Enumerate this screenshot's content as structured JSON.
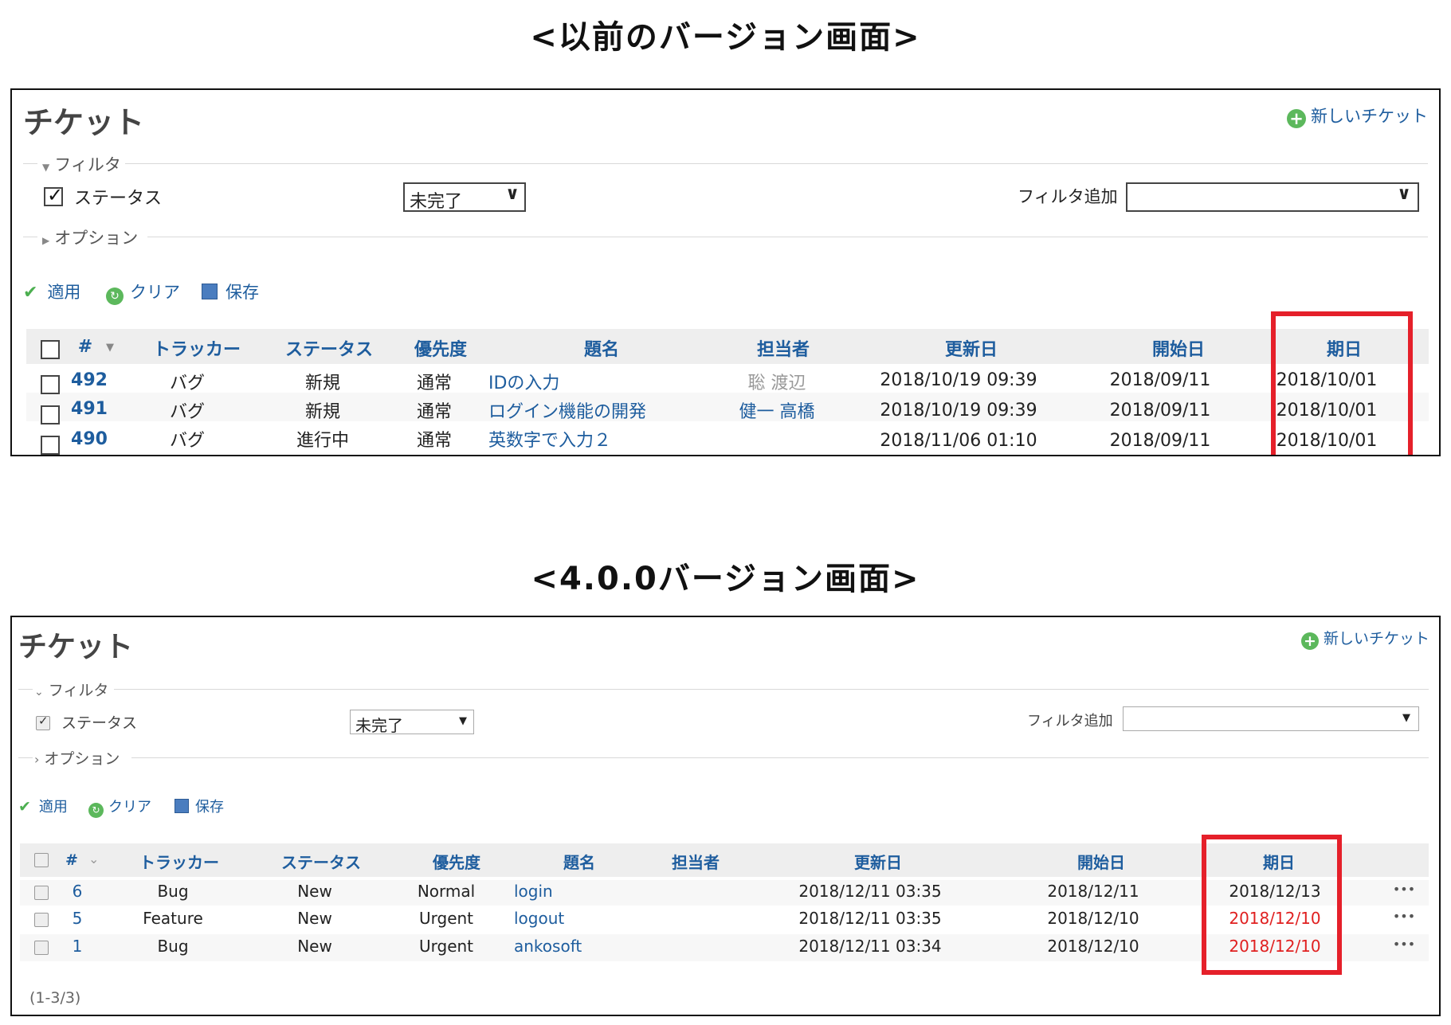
{
  "old": {
    "caption": "<以前のバージョン画面>",
    "page_title": "チケット",
    "new_ticket_label": "新しいチケット",
    "filter_legend": "フィルタ",
    "status_filter_label": "ステータス",
    "status_filter_value": "未完了",
    "add_filter_label": "フィルタ追加",
    "options_legend": "オプション",
    "apply_label": "適用",
    "clear_label": "クリア",
    "save_label": "保存",
    "headers": {
      "id": "#",
      "tracker": "トラッカー",
      "status": "ステータス",
      "priority": "優先度",
      "subject": "題名",
      "assignee": "担当者",
      "updated": "更新日",
      "start": "開始日",
      "due": "期日"
    },
    "rows": [
      {
        "id": "492",
        "tracker": "バグ",
        "status": "新規",
        "priority": "通常",
        "subject": "IDの入力",
        "assignee": "聡 渡辺",
        "updated": "2018/10/19 09:39",
        "start": "2018/09/11",
        "due": "2018/10/01"
      },
      {
        "id": "491",
        "tracker": "バグ",
        "status": "新規",
        "priority": "通常",
        "subject": "ログイン機能の開発",
        "assignee": "健一 高橋",
        "updated": "2018/10/19 09:39",
        "start": "2018/09/11",
        "due": "2018/10/01"
      },
      {
        "id": "490",
        "tracker": "バグ",
        "status": "進行中",
        "priority": "通常",
        "subject": "英数字で入力２",
        "assignee": "",
        "updated": "2018/11/06 01:10",
        "start": "2018/09/11",
        "due": "2018/10/01"
      }
    ]
  },
  "new": {
    "caption": "<4.0.0バージョン画面>",
    "page_title": "チケット",
    "new_ticket_label": "新しいチケット",
    "filter_legend": "フィルタ",
    "status_filter_label": "ステータス",
    "status_filter_value": "未完了",
    "add_filter_label": "フィルタ追加",
    "options_legend": "オプション",
    "apply_label": "適用",
    "clear_label": "クリア",
    "save_label": "保存",
    "headers": {
      "id": "#",
      "tracker": "トラッカー",
      "status": "ステータス",
      "priority": "優先度",
      "subject": "題名",
      "assignee": "担当者",
      "updated": "更新日",
      "start": "開始日",
      "due": "期日"
    },
    "rows": [
      {
        "id": "6",
        "tracker": "Bug",
        "status": "New",
        "priority": "Normal",
        "subject": "login",
        "updated": "2018/12/11 03:35",
        "start": "2018/12/11",
        "due": "2018/12/13",
        "overdue": false,
        "actions": "•••"
      },
      {
        "id": "5",
        "tracker": "Feature",
        "status": "New",
        "priority": "Urgent",
        "subject": "logout",
        "updated": "2018/12/11 03:35",
        "start": "2018/12/10",
        "due": "2018/12/10",
        "overdue": true,
        "actions": "•••"
      },
      {
        "id": "1",
        "tracker": "Bug",
        "status": "New",
        "priority": "Urgent",
        "subject": "ankosoft",
        "updated": "2018/12/11 03:34",
        "start": "2018/12/10",
        "due": "2018/12/10",
        "overdue": true,
        "actions": "•••"
      }
    ],
    "pagination": "(1-3/3)"
  },
  "colors": {
    "link": "#1e5d9e",
    "highlight": "#e5202a",
    "overdue": "#e02020",
    "header_bg": "#eeeeee"
  }
}
